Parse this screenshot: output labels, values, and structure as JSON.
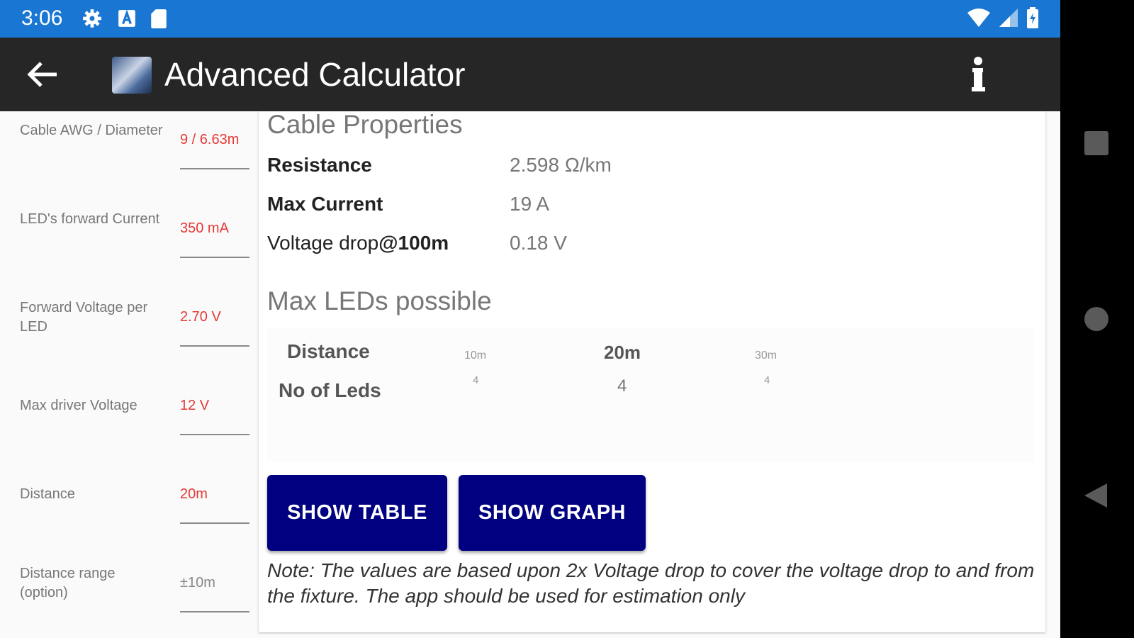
{
  "status_bar": {
    "time": "3:06"
  },
  "app_bar": {
    "title": "Advanced Calculator"
  },
  "inputs": [
    {
      "label": "Cable AWG / Diameter",
      "value": "9 / 6.63m"
    },
    {
      "label": "LED's forward Current",
      "value": "350 mA"
    },
    {
      "label": "Forward Voltage per LED",
      "value": "2.70 V"
    },
    {
      "label": "Max driver Voltage",
      "value": "12 V"
    },
    {
      "label": "Distance",
      "value": "20m"
    },
    {
      "label": "Distance range (option)",
      "value": "±10m"
    }
  ],
  "cable_properties": {
    "heading": "Cable Properties",
    "resistance_label": "Resistance",
    "resistance_value": "2.598 Ω/km",
    "max_current_label": "Max Current",
    "max_current_value": "19 A",
    "vdrop_label_a": "Voltage drop",
    "vdrop_label_b": "@100m",
    "vdrop_value": "0.18 V"
  },
  "max_leds": {
    "heading": "Max LEDs possible",
    "row1_header": "Distance",
    "row2_header": "No of Leds",
    "distances": [
      "10m",
      "20m",
      "30m"
    ],
    "counts": [
      "4",
      "4",
      "4"
    ]
  },
  "buttons": {
    "show_table": "SHOW TABLE",
    "show_graph": "SHOW GRAPH"
  },
  "note": "Note: The values are based upon 2x Voltage drop to cover the voltage drop to and from the fixture. The app should be used for estimation only",
  "colors": {
    "status_bar": "#1976d2",
    "app_bar": "#262626",
    "button": "#000080",
    "input_value": "#e53935"
  }
}
